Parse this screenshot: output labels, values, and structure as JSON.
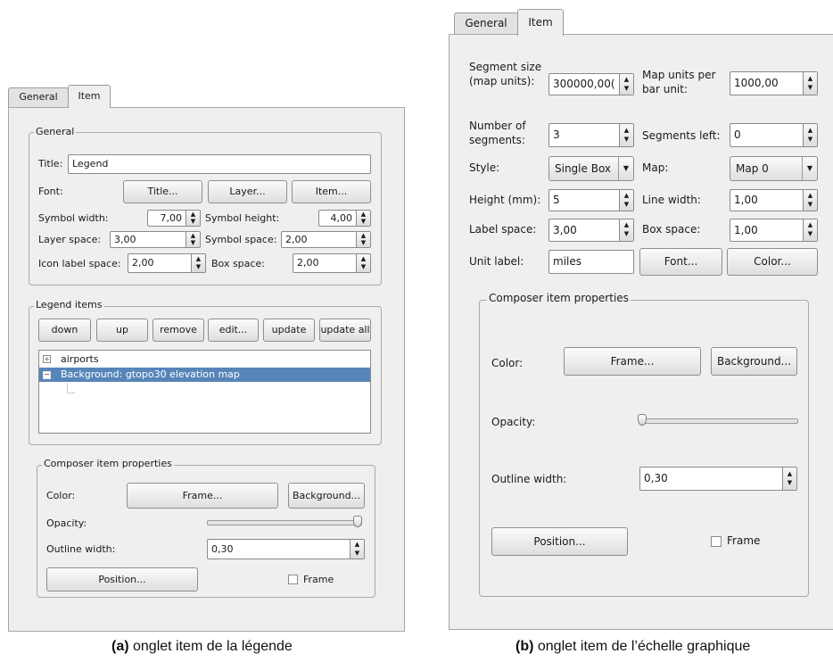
{
  "panel_a": {
    "tabs": [
      "General",
      "Item"
    ],
    "general_group": {
      "label": "General",
      "title_label": "Title:",
      "title_value": "Legend",
      "font_label": "Font:",
      "font_buttons": [
        "Title...",
        "Layer...",
        "Item..."
      ],
      "symbol_width_label": "Symbol width:",
      "symbol_width_value": "7,00",
      "symbol_height_label": "Symbol height:",
      "symbol_height_value": "4,00",
      "layer_space_label": "Layer space:",
      "layer_space_value": "3,00",
      "symbol_space_label": "Symbol space:",
      "symbol_space_value": "2,00",
      "icon_label_space_label": "Icon label space:",
      "icon_label_space_value": "2,00",
      "box_space_label": "Box space:",
      "box_space_value": "2,00"
    },
    "legend_items": {
      "label": "Legend items",
      "buttons": [
        "down",
        "up",
        "remove",
        "edit...",
        "update",
        "update all"
      ],
      "tree": [
        "airports",
        "Background: gtopo30 elevation map"
      ]
    },
    "composer": {
      "label": "Composer item properties",
      "color_label": "Color:",
      "frame_button": "Frame...",
      "background_button": "Background...",
      "opacity_label": "Opacity:",
      "opacity_fraction": 1.0,
      "outline_label": "Outline width:",
      "outline_value": "0,30",
      "position_button": "Position...",
      "frame_check_label": "Frame"
    },
    "caption_bold": "(a)",
    "caption_text": " onglet item de la légende"
  },
  "panel_b": {
    "tabs": [
      "General",
      "Item"
    ],
    "segment_size_label": "Segment size (map units):",
    "segment_size_value": "300000,00(",
    "map_units_label": "Map units per bar unit:",
    "map_units_value": "1000,00",
    "num_segments_label": "Number of segments:",
    "num_segments_value": "3",
    "segments_left_label": "Segments left:",
    "segments_left_value": "0",
    "style_label": "Style:",
    "style_value": "Single Box",
    "map_label": "Map:",
    "map_value": "Map 0",
    "height_label": "Height (mm):",
    "height_value": "5",
    "line_width_label": "Line width:",
    "line_width_value": "1,00",
    "label_space_label": "Label space:",
    "label_space_value": "3,00",
    "box_space_label": "Box space:",
    "box_space_value": "1,00",
    "unit_label_label": "Unit label:",
    "unit_label_value": "miles",
    "font_button": "Font...",
    "color_button": "Color...",
    "composer": {
      "label": "Composer item properties",
      "color_label": "Color:",
      "frame_button": "Frame...",
      "background_button": "Background...",
      "opacity_label": "Opacity:",
      "opacity_fraction": 0.0,
      "outline_label": "Outline width:",
      "outline_value": "0,30",
      "position_button": "Position...",
      "frame_check_label": "Frame"
    },
    "caption_bold": "(b)",
    "caption_text": " onglet item de l’échelle graphique"
  }
}
